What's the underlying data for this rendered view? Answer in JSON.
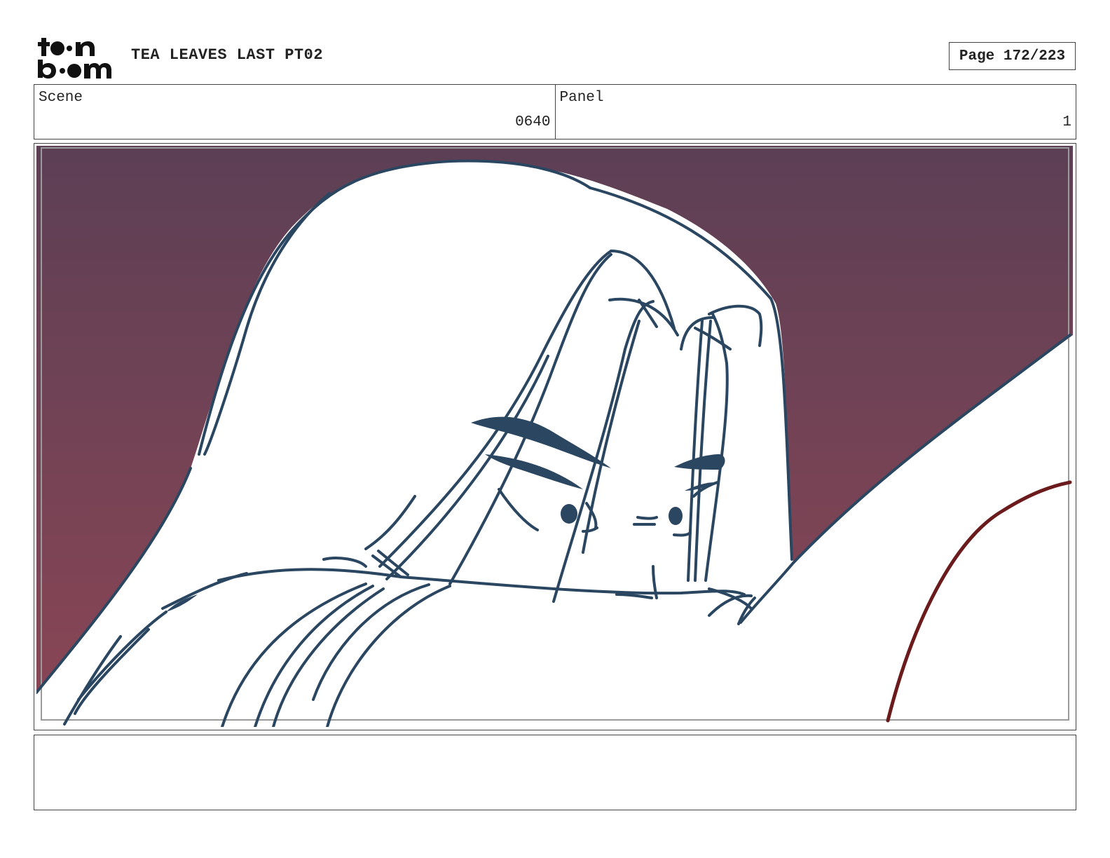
{
  "header": {
    "logo_icon": "toonboom-logo",
    "title": "TEA LEAVES LAST PT02",
    "page_label": "Page 172/223"
  },
  "scene": {
    "label": "Scene",
    "value": "0640"
  },
  "panel": {
    "label": "Panel",
    "value": "1"
  },
  "colors": {
    "background_top": "#5c3f55",
    "background_bottom": "#8b4655",
    "line": "#2a4660",
    "accent_line": "#6b1b1b"
  },
  "notes": {
    "text": ""
  }
}
